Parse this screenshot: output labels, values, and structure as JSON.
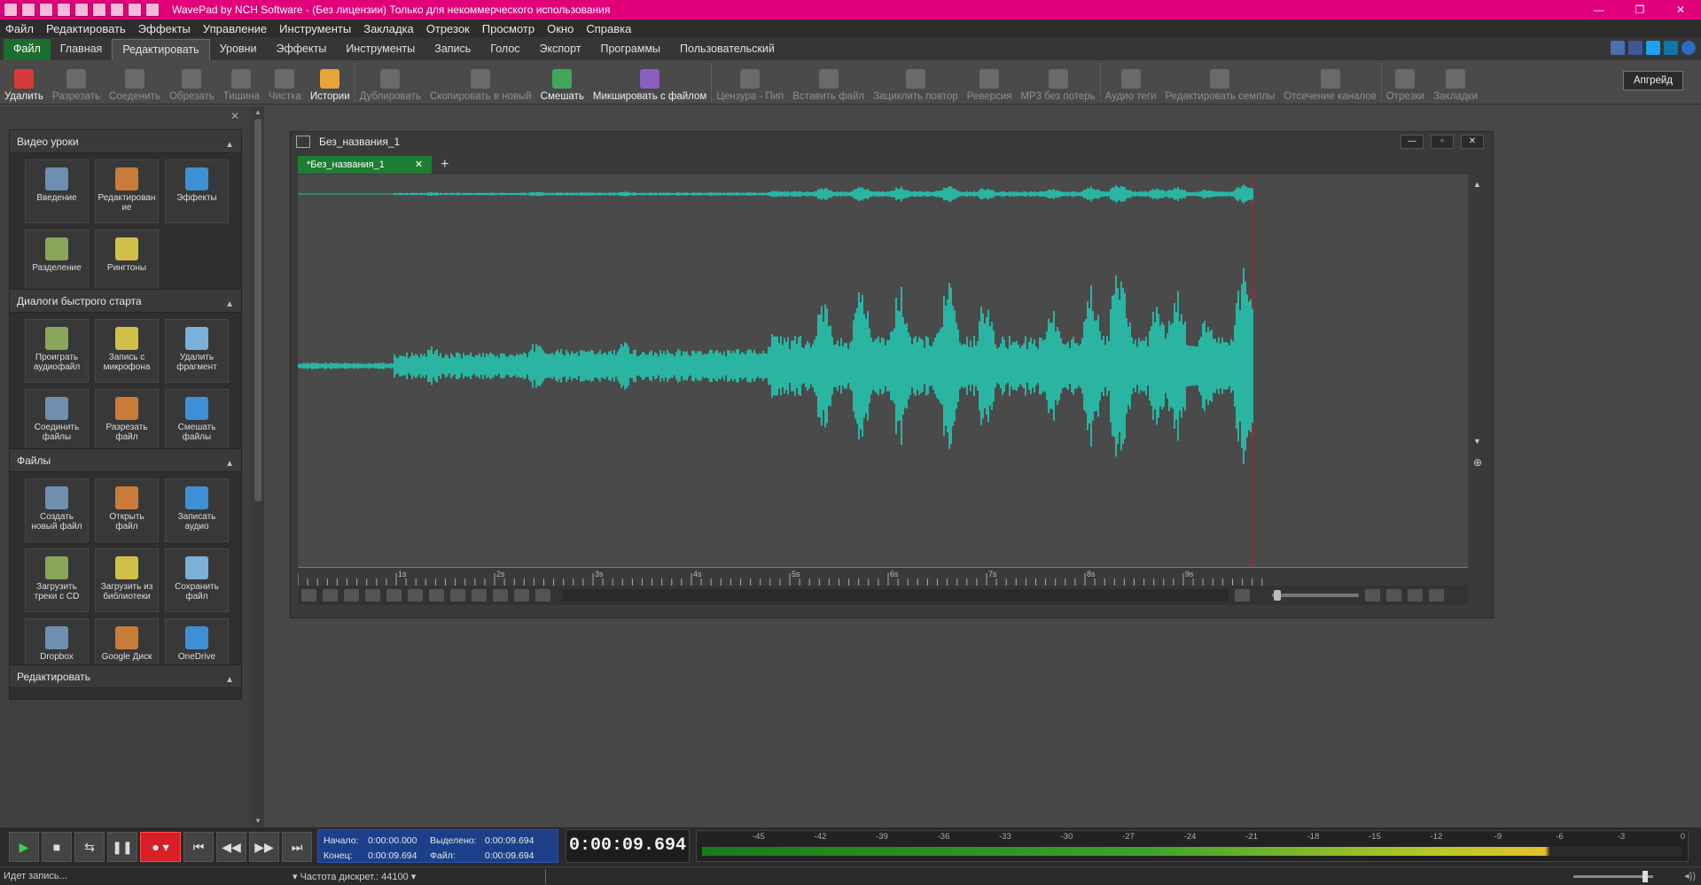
{
  "titlebar": {
    "title": "WavePad by NCH Software - (Без лицензии) Только для некоммерческого использования",
    "controls": [
      "—",
      "❐",
      "✕"
    ]
  },
  "menu": [
    "Файл",
    "Редактировать",
    "Эффекты",
    "Управление",
    "Инструменты",
    "Закладка",
    "Отрезок",
    "Просмотр",
    "Окно",
    "Справка"
  ],
  "tabs": [
    "Файл",
    "Главная",
    "Редактировать",
    "Уровни",
    "Эффекты",
    "Инструменты",
    "Запись",
    "Голос",
    "Экспорт",
    "Программы",
    "Пользовательский"
  ],
  "toolbar": [
    {
      "label": "Удалить",
      "icon": "delete-icon",
      "on": true
    },
    {
      "label": "Разрезать",
      "icon": "split-icon"
    },
    {
      "label": "Соеденить",
      "icon": "join-icon"
    },
    {
      "label": "Обрезать",
      "icon": "trim-icon"
    },
    {
      "label": "Тишина",
      "icon": "silence-icon"
    },
    {
      "label": "Чистка",
      "icon": "clean-icon"
    },
    {
      "label": "Истории",
      "icon": "history-icon",
      "on": true
    },
    {
      "label": "Дублировать",
      "icon": "duplicate-icon"
    },
    {
      "label": "Скопировать в новый",
      "icon": "copy-to-new-icon"
    },
    {
      "label": "Смешать",
      "icon": "mix-icon",
      "on": true
    },
    {
      "label": "Микшировать с файлом",
      "icon": "mix-file-icon",
      "on": true
    },
    {
      "label": "Цензура - Пип",
      "icon": "censor-icon"
    },
    {
      "label": "Вставить файл",
      "icon": "insert-file-icon"
    },
    {
      "label": "Зациклить повтор",
      "icon": "loop-icon"
    },
    {
      "label": "Реверсия",
      "icon": "reverse-icon"
    },
    {
      "label": "MP3 без потерь",
      "icon": "mp3-icon"
    },
    {
      "label": "Аудио теги",
      "icon": "tags-icon"
    },
    {
      "label": "Редактировать семплы",
      "icon": "edit-samples-icon"
    },
    {
      "label": "Отсечение каналов",
      "icon": "channel-cut-icon"
    },
    {
      "label": "Отрезки",
      "icon": "regions-icon"
    },
    {
      "label": "Закладки",
      "icon": "bookmarks-icon"
    }
  ],
  "upgrade": "Апгрейд",
  "panels": [
    {
      "title": "Видео уроки",
      "items": [
        {
          "label": "Введение",
          "icon": "lightbulb-icon"
        },
        {
          "label": "Редактирован ие",
          "icon": "edit-icon"
        },
        {
          "label": "Эффекты",
          "icon": "effects-icon"
        },
        {
          "label": "Разделение",
          "icon": "split-icon"
        },
        {
          "label": "Рингтоны",
          "icon": "ringtone-icon"
        }
      ]
    },
    {
      "title": "Диалоги быстрого старта",
      "items": [
        {
          "label": "Проиграть аудиофайл",
          "icon": "play-file-icon"
        },
        {
          "label": "Запись с микрофона",
          "icon": "microphone-icon"
        },
        {
          "label": "Удалить фрагмент",
          "icon": "delete-fragment-icon"
        },
        {
          "label": "Соединить файлы",
          "icon": "join-files-icon"
        },
        {
          "label": "Разрезать файл",
          "icon": "scissors-icon"
        },
        {
          "label": "Смешать файлы",
          "icon": "mix-files-icon"
        }
      ]
    },
    {
      "title": "Файлы",
      "items": [
        {
          "label": "Создать новый файл",
          "icon": "new-file-icon"
        },
        {
          "label": "Открыть файл",
          "icon": "open-folder-icon"
        },
        {
          "label": "Записать аудио",
          "icon": "record-audio-icon"
        },
        {
          "label": "Загрузить треки с CD",
          "icon": "cd-icon"
        },
        {
          "label": "Загрузить из библиотеки",
          "icon": "library-icon"
        },
        {
          "label": "Сохранить файл",
          "icon": "save-icon"
        },
        {
          "label": "Dropbox",
          "icon": "dropbox-icon"
        },
        {
          "label": "Google Диск",
          "icon": "google-drive-icon"
        },
        {
          "label": "OneDrive",
          "icon": "onedrive-icon"
        }
      ]
    },
    {
      "title": "Редактировать",
      "items": []
    }
  ],
  "document": {
    "title": "Без_названия_1",
    "tab": "*Без_названия_1",
    "ruler": [
      "1s",
      "2s",
      "3s",
      "4s",
      "5s",
      "6s",
      "7s",
      "8s",
      "9s"
    ]
  },
  "selection": {
    "start_label": "Начало:",
    "start": "0:00:00.000",
    "end_label": "Конец:",
    "end": "0:00:09.694",
    "sel_label": "Выделено:",
    "sel": "0:00:09.694",
    "file_label": "Файл:",
    "file": "0:00:09.694"
  },
  "time": "0:00:09.694",
  "meter_scale": [
    "-45",
    "-42",
    "-39",
    "-36",
    "-33",
    "-30",
    "-27",
    "-24",
    "-21",
    "-18",
    "-15",
    "-12",
    "-9",
    "-6",
    "-3",
    "0"
  ],
  "status": {
    "left": "Идет запись...",
    "rate": "Частота дискрет.: 44100"
  },
  "colors": {
    "waveform": "#29b5a1",
    "title": "#e2007a",
    "file_tab": "#1a6f2e",
    "record": "#d81f26",
    "selection": "#1d3f8a"
  }
}
